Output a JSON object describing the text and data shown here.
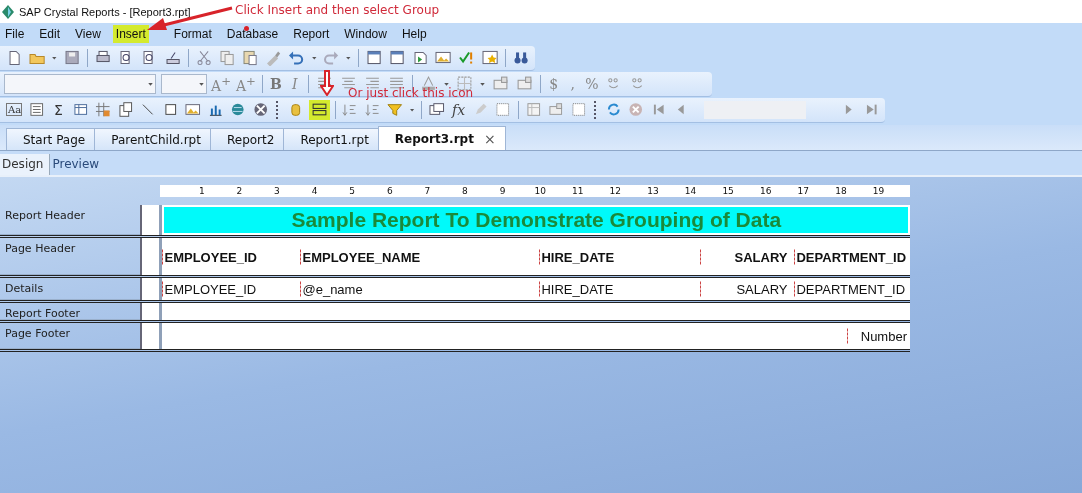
{
  "window": {
    "title": "SAP Crystal Reports - [Report3.rpt]"
  },
  "menu": [
    {
      "label": "File",
      "highlighted": false
    },
    {
      "label": "Edit",
      "highlighted": false
    },
    {
      "label": "View",
      "highlighted": false
    },
    {
      "label": "Insert",
      "highlighted": true
    },
    {
      "label": "Format",
      "highlighted": false
    },
    {
      "label": "Database",
      "highlighted": false
    },
    {
      "label": "Report",
      "highlighted": false
    },
    {
      "label": "Window",
      "highlighted": false
    },
    {
      "label": "Help",
      "highlighted": false
    }
  ],
  "glyphs": {
    "grow_font": "A$^{+}$",
    "shrink_font": "A$^{+}$",
    "bold": "B",
    "italic": "I",
    "currency": "$",
    "thousands": ",",
    "percent": "%",
    "text_object": "Aa",
    "summary": "Σ",
    "formula": "fx"
  },
  "group_button": {
    "highlighted": true
  },
  "tabs": [
    {
      "label": "Start Page",
      "selected": false,
      "closable": false
    },
    {
      "label": "ParentChild.rpt",
      "selected": false,
      "closable": false
    },
    {
      "label": "Report2",
      "selected": false,
      "closable": false
    },
    {
      "label": "Report1.rpt",
      "selected": false,
      "closable": false
    },
    {
      "label": "Report3.rpt",
      "selected": true,
      "closable": true,
      "close_glyph": "×"
    }
  ],
  "view_tabs": [
    {
      "label": "Design",
      "selected": true
    },
    {
      "label": "Preview",
      "selected": false
    }
  ],
  "ruler": [
    "1",
    "2",
    "3",
    "4",
    "5",
    "6",
    "7",
    "8",
    "9",
    "10",
    "11",
    "12",
    "13",
    "14",
    "15",
    "16",
    "17",
    "18",
    "19"
  ],
  "sections": [
    {
      "label": "Report Header",
      "fields": [
        {
          "kind": "title",
          "text": "Sample Report To Demonstrate Grouping of Data"
        }
      ]
    },
    {
      "label": "Page Header",
      "fields": [
        {
          "kind": "column",
          "text": "EMPLOYEE_ID",
          "bold": true
        },
        {
          "kind": "column",
          "text": "EMPLOYEE_NAME",
          "bold": true
        },
        {
          "kind": "column",
          "text": "HIRE_DATE",
          "bold": true
        },
        {
          "kind": "column",
          "text": "SALARY",
          "bold": true
        },
        {
          "kind": "column",
          "text": "DEPARTMENT_ID",
          "bold": true
        }
      ]
    },
    {
      "label": "Details",
      "fields": [
        {
          "kind": "column",
          "text": "EMPLOYEE_ID",
          "bold": false
        },
        {
          "kind": "column",
          "text": "@e_name",
          "bold": false
        },
        {
          "kind": "column",
          "text": "HIRE_DATE",
          "bold": false
        },
        {
          "kind": "column",
          "text": "SALARY",
          "bold": false
        },
        {
          "kind": "column",
          "text": "DEPARTMENT_ID",
          "bold": false
        }
      ]
    },
    {
      "label": "Report Footer"
    },
    {
      "label": "Page Footer",
      "fields": [
        {
          "kind": "page_number",
          "text": "Number"
        }
      ]
    }
  ],
  "annotations": [
    {
      "kind": "menu",
      "text": "Click Insert and then select Group"
    },
    {
      "kind": "icon",
      "text": "Or just click this icon"
    }
  ]
}
